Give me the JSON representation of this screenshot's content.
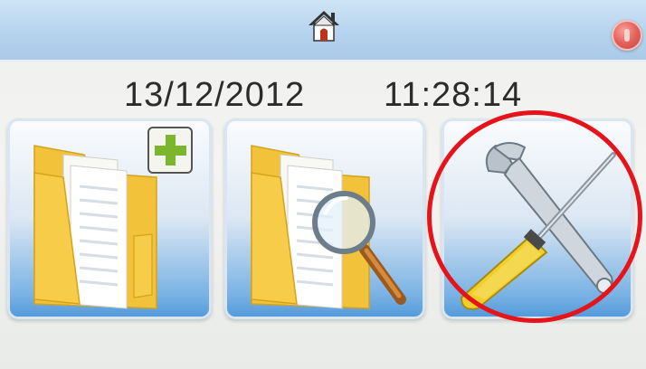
{
  "header": {
    "home_icon": "home-icon",
    "power_icon": "power-icon"
  },
  "status": {
    "date": "13/12/2012",
    "time": "11:28:14"
  },
  "tiles": [
    {
      "icon": "folder-add-icon"
    },
    {
      "icon": "folder-search-icon"
    },
    {
      "icon": "tools-icon"
    }
  ],
  "colors": {
    "header_blue": "#b6d3ee",
    "tile_blue": "#4f98d9",
    "folder_yellow": "#f4c63d",
    "plus_green": "#7bb62c",
    "power_red": "#e4625c",
    "highlight_red": "#e5141b"
  }
}
